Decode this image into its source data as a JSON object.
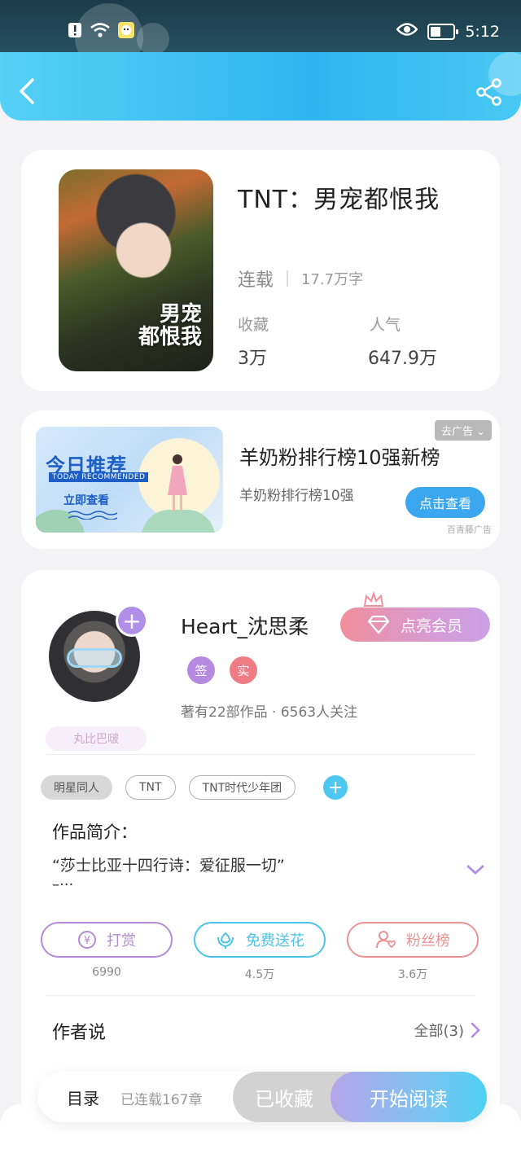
{
  "status_bar": {
    "time": "5:12",
    "battery_level": 0.45,
    "icons": [
      "alert-icon",
      "wifi-icon",
      "app-notification-icon",
      "eye-icon",
      "battery-icon"
    ]
  },
  "header": {
    "icons": [
      "back-arrow-icon",
      "share-icon"
    ],
    "accent": "#2eb6f0"
  },
  "book": {
    "title": "TNT：男宠都恨我",
    "cover_text": "男宠\n都恨我",
    "status": "连载",
    "word_count": "17.7万字",
    "favorites_label": "收藏",
    "favorites_value": "3万",
    "popularity_label": "人气",
    "popularity_value": "647.9万"
  },
  "ad": {
    "image_title": "今日推荐",
    "image_subtitle": "TODAY RECOMMENDED",
    "image_button": "立即查看",
    "close_label": "去广告",
    "title": "羊奶粉排行榜10强新榜",
    "subtitle": "羊奶粉排行榜10强",
    "cta": "点击查看",
    "source": "百青藤广告"
  },
  "author": {
    "name": "Heart_沈思柔",
    "vip_button": "点亮会员",
    "badge_signed": "签",
    "badge_verified": "实",
    "meta": "著有22部作品 · 6563人关注",
    "fan_badge": "丸比巴啵",
    "badge_colors": {
      "signed": "#b68ae0",
      "verified": "#ef7c84"
    }
  },
  "tags": [
    "明星同人",
    "TNT",
    "TNT时代少年团"
  ],
  "intro": {
    "heading": "作品简介：",
    "text": "“莎士比亚十四行诗：爱征服一切”",
    "more": "–··· "
  },
  "actions": [
    {
      "label": "打赏",
      "count": "6990",
      "color": "#b48bd8",
      "icon": "coin-icon"
    },
    {
      "label": "免费送花",
      "count": "4.5万",
      "color": "#4cc4ea",
      "icon": "flower-icon"
    },
    {
      "label": "粉丝榜",
      "count": "3.6万",
      "color": "#e99393",
      "icon": "fans-icon"
    }
  ],
  "author_says": {
    "heading": "作者说",
    "all_label": "全部(3)"
  },
  "bottom_bar": {
    "toc_label": "目录",
    "toc_sub": "已连载167章",
    "collected_label": "已收藏",
    "read_label": "开始阅读"
  }
}
